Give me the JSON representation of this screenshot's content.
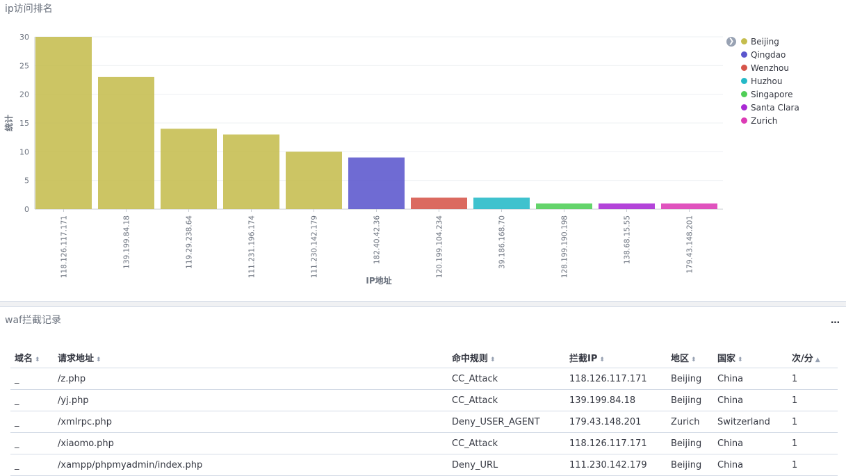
{
  "chart_panel": {
    "title": "ip访问排名"
  },
  "chart_data": {
    "type": "bar",
    "title": "ip访问排名",
    "xlabel": "IP地址",
    "ylabel": "统计",
    "ylim": [
      0,
      30
    ],
    "yticks": [
      0,
      5,
      10,
      15,
      20,
      25,
      30
    ],
    "categories": [
      "118.126.117.171",
      "139.199.84.18",
      "119.29.238.64",
      "111.231.196.174",
      "111.230.142.179",
      "182.40.42.36",
      "120.199.104.234",
      "39.186.168.70",
      "128.199.190.198",
      "138.68.15.55",
      "179.43.148.201"
    ],
    "values": [
      30,
      23,
      14,
      13,
      10,
      9,
      2,
      2,
      1,
      1,
      1
    ],
    "bar_series": [
      "Beijing",
      "Beijing",
      "Beijing",
      "Beijing",
      "Beijing",
      "Qingdao",
      "Wenzhou",
      "Huzhou",
      "Singapore",
      "Santa Clara",
      "Zurich"
    ],
    "legend": [
      {
        "name": "Beijing",
        "color": "#c5bd4e"
      },
      {
        "name": "Qingdao",
        "color": "#5b56cd"
      },
      {
        "name": "Wenzhou",
        "color": "#d6554a"
      },
      {
        "name": "Huzhou",
        "color": "#24b9c7"
      },
      {
        "name": "Singapore",
        "color": "#4fce56"
      },
      {
        "name": "Santa Clara",
        "color": "#a92ad4"
      },
      {
        "name": "Zurich",
        "color": "#dc3bb5"
      }
    ],
    "legend_position": "right",
    "grid": true
  },
  "table_panel": {
    "title": "waf拦截记录",
    "menu_icon": "…",
    "columns": [
      "域名",
      "请求地址",
      "命中规则",
      "拦截IP",
      "地区",
      "国家",
      "次/分"
    ],
    "rows": [
      [
        "_",
        "/z.php",
        "CC_Attack",
        "118.126.117.171",
        "Beijing",
        "China",
        "1"
      ],
      [
        "_",
        "/yj.php",
        "CC_Attack",
        "139.199.84.18",
        "Beijing",
        "China",
        "1"
      ],
      [
        "_",
        "/xmlrpc.php",
        "Deny_USER_AGENT",
        "179.43.148.201",
        "Zurich",
        "Switzerland",
        "1"
      ],
      [
        "_",
        "/xiaomo.php",
        "CC_Attack",
        "118.126.117.171",
        "Beijing",
        "China",
        "1"
      ],
      [
        "_",
        "/xampp/phpmyadmin/index.php",
        "Deny_URL",
        "111.230.142.179",
        "Beijing",
        "China",
        "1"
      ]
    ]
  }
}
